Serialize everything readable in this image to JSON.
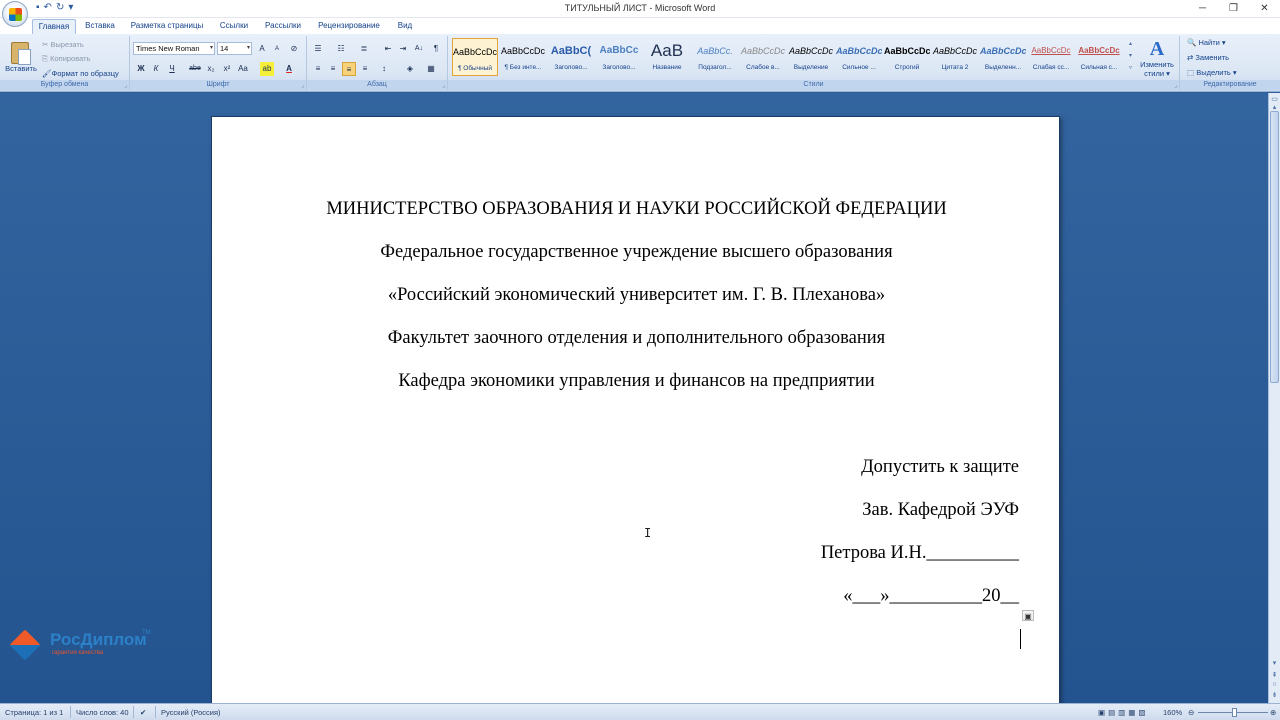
{
  "window": {
    "title": "ТИТУЛЬНЫЙ ЛИСТ - Microsoft Word",
    "controls": {
      "minimize": "─",
      "restore": "❐",
      "close": "✕"
    }
  },
  "quick_access": {
    "save_icon": "save-icon",
    "undo": "↶",
    "redo": "↻",
    "customize": "▾"
  },
  "tabs": [
    "Главная",
    "Вставка",
    "Разметка страницы",
    "Ссылки",
    "Рассылки",
    "Рецензирование",
    "Вид"
  ],
  "active_tab": "Главная",
  "clipboard": {
    "paste_label": "Вставить",
    "cut_label": "Вырезать",
    "copy_label": "Копировать",
    "format_painter_label": "Формат по образцу",
    "group_label": "Буфер обмена"
  },
  "font": {
    "name": "Times New Roman",
    "size": "14",
    "group_label": "Шрифт",
    "bold": "Ж",
    "italic": "К",
    "underline": "Ч",
    "strike": "abe",
    "subscript": "x₂",
    "superscript": "x²",
    "case": "Aa",
    "grow": "A",
    "shrink": "A",
    "clear": "⊘",
    "highlight": "ab",
    "color": "A"
  },
  "paragraph": {
    "group_label": "Абзац",
    "sort": "A↓",
    "pilcrow": "¶"
  },
  "styles": {
    "group_label": "Стили",
    "items": [
      {
        "sample": "AaBbCcDc",
        "name": "¶ Обычный",
        "selected": true
      },
      {
        "sample": "AaBbCcDc",
        "name": "¶ Без инте...",
        "selected": false
      },
      {
        "sample": "AaBbC(",
        "name": "Заголово...",
        "selected": false
      },
      {
        "sample": "AaBbCc",
        "name": "Заголово...",
        "selected": false
      },
      {
        "sample": "AaB",
        "name": "Название",
        "selected": false
      },
      {
        "sample": "AaBbCc.",
        "name": "Подзагол...",
        "selected": false
      },
      {
        "sample": "AaBbCcDc",
        "name": "Слабое в...",
        "selected": false
      },
      {
        "sample": "AaBbCcDc",
        "name": "Выделение",
        "selected": false
      },
      {
        "sample": "AaBbCcDc",
        "name": "Сильное ...",
        "selected": false
      },
      {
        "sample": "AaBbCcDc",
        "name": "Строгий",
        "selected": false
      },
      {
        "sample": "AaBbCcDc",
        "name": "Цитата 2",
        "selected": false
      },
      {
        "sample": "AaBbCcDc",
        "name": "Выделенн...",
        "selected": false
      },
      {
        "sample": "AaBbCcDc",
        "name": "Слабая сс...",
        "selected": false
      },
      {
        "sample": "AaBbCcDc",
        "name": "Сильная с...",
        "selected": false
      }
    ],
    "change_label_1": "Изменить",
    "change_label_2": "стили ▾"
  },
  "editing": {
    "group_label": "Редактирование",
    "find": "Найти ▾",
    "replace": "Заменить",
    "select": "Выделить ▾"
  },
  "document": {
    "lines_center": [
      "МИНИСТЕРСТВО ОБРАЗОВАНИЯ И НАУКИ РОССИЙСКОЙ ФЕДЕРАЦИИ",
      "Федеральное государственное учреждение высшего образования",
      "«Российский экономический университет им. Г. В. Плеханова»",
      "Факультет заочного отделения и дополнительного образования",
      "Кафедра экономики управления и финансов на предприятии"
    ],
    "lines_right": [
      "Допустить к защите",
      "Зав. Кафедрой ЭУФ",
      "Петрова И.Н.__________",
      "«___»__________20__"
    ]
  },
  "watermark": {
    "name": "РосДиплом",
    "tm": "TM",
    "slogan": "гарантия качества"
  },
  "statusbar": {
    "page": "Страница: 1 из 1",
    "words": "Число слов: 40",
    "language": "Русский (Россия)",
    "zoom": "160%"
  }
}
